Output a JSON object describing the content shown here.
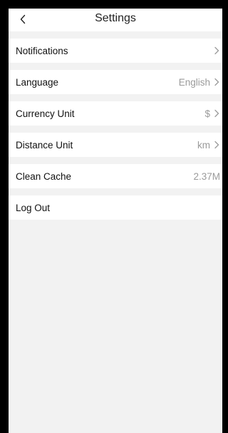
{
  "header": {
    "title": "Settings",
    "back_icon": "chevron-left-icon"
  },
  "rows": [
    {
      "label": "Notifications",
      "value": "",
      "has_chevron": true
    },
    {
      "label": "Language",
      "value": "English",
      "has_chevron": true
    },
    {
      "label": "Currency Unit",
      "value": "$",
      "has_chevron": true
    },
    {
      "label": "Distance Unit",
      "value": "km",
      "has_chevron": true
    },
    {
      "label": "Clean Cache",
      "value": "2.37M",
      "has_chevron": false
    },
    {
      "label": "Log Out",
      "value": "",
      "has_chevron": false
    }
  ],
  "colors": {
    "background": "#f2f2f2",
    "row": "#ffffff",
    "secondary_text": "#9a9a9a"
  }
}
